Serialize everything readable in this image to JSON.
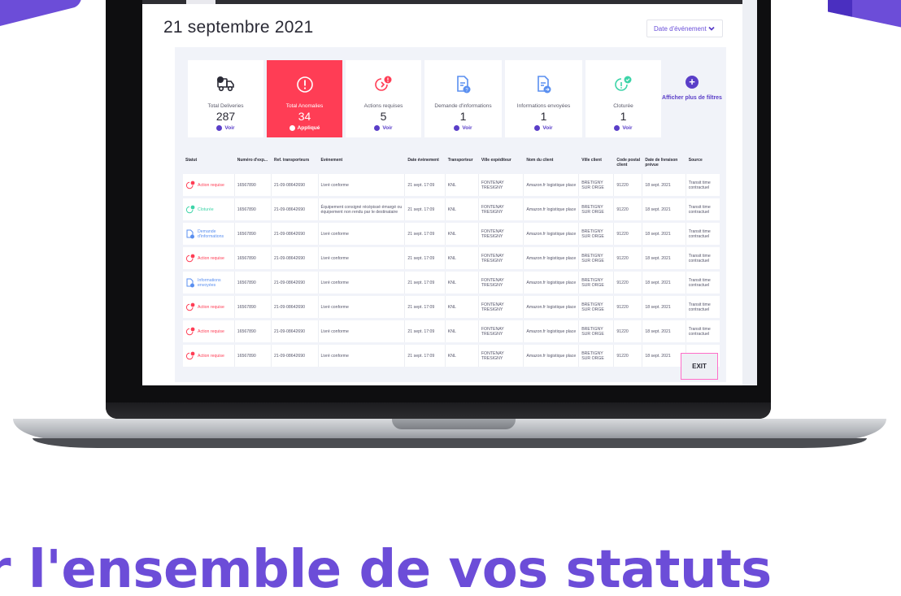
{
  "colors": {
    "accent": "#5a3ec8",
    "alert": "#ff3d55",
    "success": "#3dd4a8",
    "info": "#5a8ff0",
    "brand": "#6c4dd8"
  },
  "header": {
    "date_title": "21 septembre 2021",
    "date_filter_label": "Date d'événement"
  },
  "cards": [
    {
      "label": "Total Deliveries",
      "value": "287",
      "action": "Voir",
      "icon": "truck-icon"
    },
    {
      "label": "Total Anomalies",
      "value": "34",
      "action": "Appliqué",
      "icon": "alert-circle-icon"
    },
    {
      "label": "Actions requises",
      "value": "5",
      "action": "Voir",
      "icon": "action-required-icon"
    },
    {
      "label": "Demande d'informations",
      "value": "1",
      "action": "Voir",
      "icon": "document-question-icon"
    },
    {
      "label": "Informations envoyées",
      "value": "1",
      "action": "Voir",
      "icon": "document-send-icon"
    },
    {
      "label": "Cloturée",
      "value": "1",
      "action": "Voir",
      "icon": "closed-check-icon"
    }
  ],
  "more_filters": {
    "label": "Afficher plus de filtres",
    "icon": "plus-circle-icon"
  },
  "table": {
    "columns": [
      "Statut",
      "Numéro d'exp...",
      "Ref. transporteurs",
      "Evènement",
      "Date évènement",
      "Transporteur",
      "Ville expéditeur",
      "Nom du client",
      "Ville client",
      "Code postal client",
      "Date de livraison prévue",
      "Source"
    ],
    "rows": [
      {
        "status": "Action requise",
        "kind": "red",
        "num": "16567890",
        "ref": "21-09-08642690",
        "event": "Livré conforme",
        "date": "21 sept. 17:09",
        "carrier": "KNL",
        "city_from": "FONTENAY TRESIGNY",
        "client": "Amazon.fr logistique place",
        "city_client": "BRETIGNY SUR ORGE",
        "postal": "91220",
        "delivery": "18 sept. 2021",
        "source": "Transit time contractuel"
      },
      {
        "status": "Cloturée",
        "kind": "green",
        "num": "16567890",
        "ref": "21-09-08642690",
        "event": "Équipement consigné récépissé émargé ou équipement non rendu par le destinataire",
        "date": "21 sept. 17:09",
        "carrier": "KNL",
        "city_from": "FONTENAY TRESIGNY",
        "client": "Amazon.fr logistique place",
        "city_client": "BRETIGNY SUR ORGE",
        "postal": "91220",
        "delivery": "18 sept. 2021",
        "source": "Transit time contractuel"
      },
      {
        "status": "Demande d'informations",
        "kind": "blue",
        "num": "16567890",
        "ref": "21-09-08642690",
        "event": "Livré conforme",
        "date": "21 sept. 17:09",
        "carrier": "KNL",
        "city_from": "FONTENAY TRESIGNY",
        "client": "Amazon.fr logistique place",
        "city_client": "BRETIGNY SUR ORGE",
        "postal": "91220",
        "delivery": "18 sept. 2021",
        "source": "Transit time contractuel"
      },
      {
        "status": "Action requise",
        "kind": "red",
        "num": "16567890",
        "ref": "21-09-08642690",
        "event": "Livré conforme",
        "date": "21 sept. 17:09",
        "carrier": "KNL",
        "city_from": "FONTENAY TRESIGNY",
        "client": "Amazon.fr logistique place",
        "city_client": "BRETIGNY SUR ORGE",
        "postal": "91220",
        "delivery": "18 sept. 2021",
        "source": "Transit time contractuel"
      },
      {
        "status": "Informations envoyées",
        "kind": "blue",
        "num": "16567890",
        "ref": "21-09-08642690",
        "event": "Livré conforme",
        "date": "21 sept. 17:09",
        "carrier": "KNL",
        "city_from": "FONTENAY TRESIGNY",
        "client": "Amazon.fr logistique place",
        "city_client": "BRETIGNY SUR ORGE",
        "postal": "91220",
        "delivery": "18 sept. 2021",
        "source": "Transit time contractuel"
      },
      {
        "status": "Action requise",
        "kind": "red",
        "num": "16567890",
        "ref": "21-09-08642690",
        "event": "Livré conforme",
        "date": "21 sept. 17:09",
        "carrier": "KNL",
        "city_from": "FONTENAY TRESIGNY",
        "client": "Amazon.fr logistique place",
        "city_client": "BRETIGNY SUR ORGE",
        "postal": "91220",
        "delivery": "18 sept. 2021",
        "source": "Transit time contractuel"
      },
      {
        "status": "Action requise",
        "kind": "red",
        "num": "16567890",
        "ref": "21-09-08642690",
        "event": "Livré conforme",
        "date": "21 sept. 17:09",
        "carrier": "KNL",
        "city_from": "FONTENAY TRESIGNY",
        "client": "Amazon.fr logistique place",
        "city_client": "BRETIGNY SUR ORGE",
        "postal": "91220",
        "delivery": "18 sept. 2021",
        "source": "Transit time contractuel"
      },
      {
        "status": "Action requise",
        "kind": "red",
        "num": "16567890",
        "ref": "21-09-08642690",
        "event": "Livré conforme",
        "date": "21 sept. 17:09",
        "carrier": "KNL",
        "city_from": "FONTENAY TRESIGNY",
        "client": "Amazon.fr logistique place",
        "city_client": "BRETIGNY SUR ORGE",
        "postal": "91220",
        "delivery": "18 sept. 2021",
        "source": "Transit time"
      }
    ]
  },
  "exit_label": "EXIT",
  "headline": "r l'ensemble de vos statuts"
}
